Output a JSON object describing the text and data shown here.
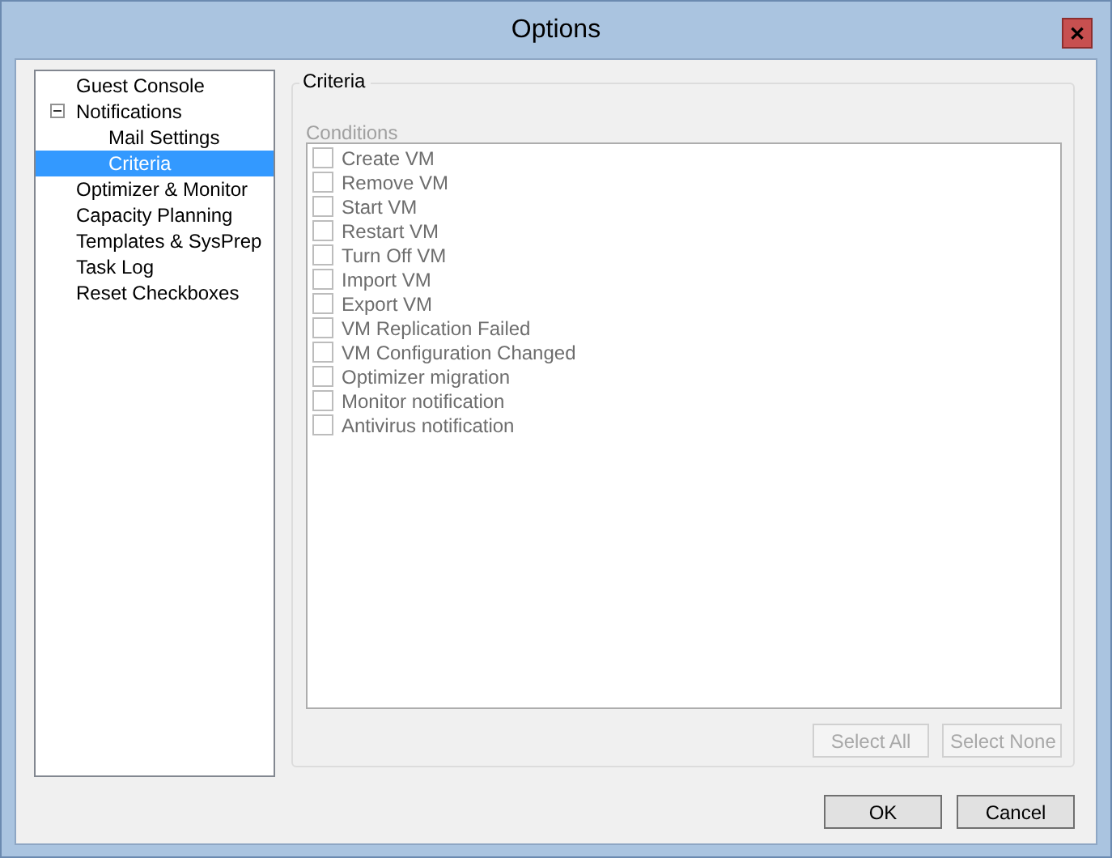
{
  "window": {
    "title": "Options",
    "close": "✕"
  },
  "tree": [
    {
      "label": "Guest Console",
      "selected": false
    },
    {
      "label": "Notifications",
      "selected": false,
      "expanded": true,
      "children": [
        {
          "label": "Mail Settings",
          "selected": false
        },
        {
          "label": "Criteria",
          "selected": true
        }
      ]
    },
    {
      "label": "Optimizer & Monitor",
      "selected": false
    },
    {
      "label": "Capacity Planning",
      "selected": false
    },
    {
      "label": "Templates & SysPrep",
      "selected": false
    },
    {
      "label": "Task Log",
      "selected": false
    },
    {
      "label": "Reset Checkboxes",
      "selected": false
    }
  ],
  "group": {
    "title": "Criteria",
    "list_label": "Conditions",
    "disabled": true,
    "conditions": [
      {
        "label": "Create VM",
        "checked": false
      },
      {
        "label": "Remove VM",
        "checked": false
      },
      {
        "label": "Start VM",
        "checked": false
      },
      {
        "label": "Restart VM",
        "checked": false
      },
      {
        "label": "Turn Off VM",
        "checked": false
      },
      {
        "label": "Import VM",
        "checked": false
      },
      {
        "label": "Export VM",
        "checked": false
      },
      {
        "label": "VM Replication Failed",
        "checked": false
      },
      {
        "label": "VM Configuration Changed",
        "checked": false
      },
      {
        "label": "Optimizer migration",
        "checked": false
      },
      {
        "label": "Monitor notification",
        "checked": false
      },
      {
        "label": "Antivirus notification",
        "checked": false
      }
    ],
    "buttons": [
      {
        "label": "Select All",
        "disabled": true
      },
      {
        "label": "Select None",
        "disabled": true
      }
    ]
  },
  "buttons": [
    {
      "label": "OK",
      "disabled": false
    },
    {
      "label": "Cancel",
      "disabled": false
    }
  ]
}
